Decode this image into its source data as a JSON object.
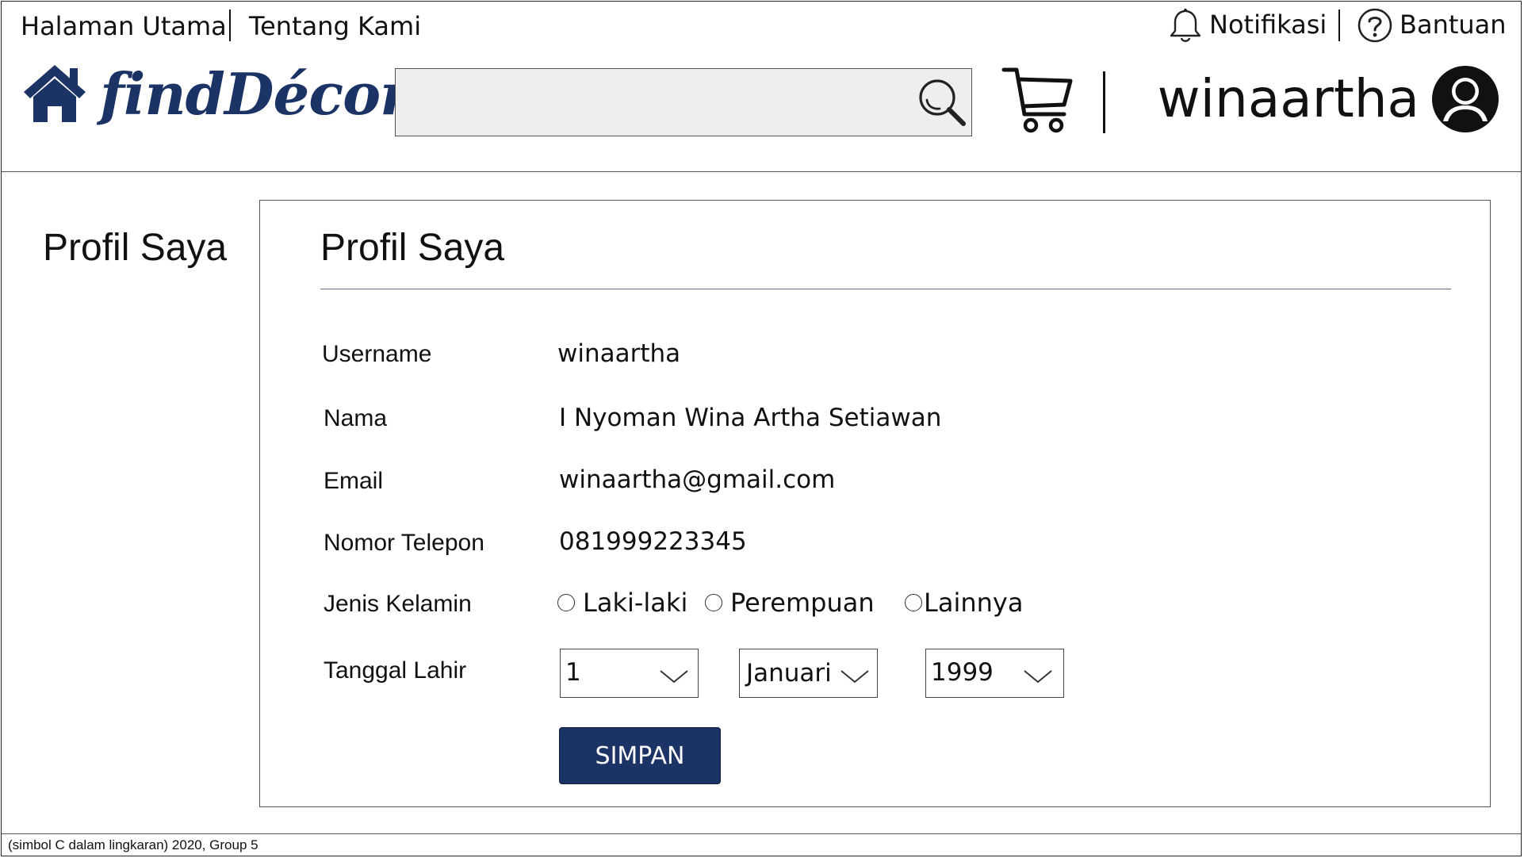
{
  "topbar": {
    "links": [
      {
        "label": "Halaman Utama"
      },
      {
        "label": "Tentang Kami"
      }
    ],
    "notifications_label": "Notifikasi",
    "help_label": "Bantuan"
  },
  "brand": {
    "name": "findDécor",
    "color": "#1c3366"
  },
  "search": {
    "value": "",
    "placeholder": ""
  },
  "user": {
    "username": "winaartha"
  },
  "sidebar": {
    "title": "Profil Saya"
  },
  "profile": {
    "title": "Profil Saya",
    "fields": {
      "username": {
        "label": "Username",
        "value": "winaartha"
      },
      "name": {
        "label": "Nama",
        "value": "I Nyoman Wina Artha Setiawan"
      },
      "email": {
        "label": "Email",
        "value": "winaartha@gmail.com"
      },
      "phone": {
        "label": "Nomor Telepon",
        "value": "081999223345"
      }
    },
    "gender": {
      "label": "Jenis Kelamin",
      "options": [
        "Laki-laki",
        "Perempuan",
        "Lainnya"
      ],
      "selected": null
    },
    "birth_date": {
      "label": "Tanggal Lahir",
      "day": "1",
      "month": "Januari",
      "year": "1999"
    },
    "save_label": "SIMPAN"
  },
  "footer": {
    "text": "(simbol C dalam lingkaran) 2020, Group 5"
  },
  "colors": {
    "accent": "#1c3366",
    "search_bg": "#eeeeee"
  },
  "icons": [
    "home-icon",
    "search-icon",
    "cart-icon",
    "avatar-icon",
    "bell-icon",
    "help-icon",
    "chevron-down-icon"
  ]
}
